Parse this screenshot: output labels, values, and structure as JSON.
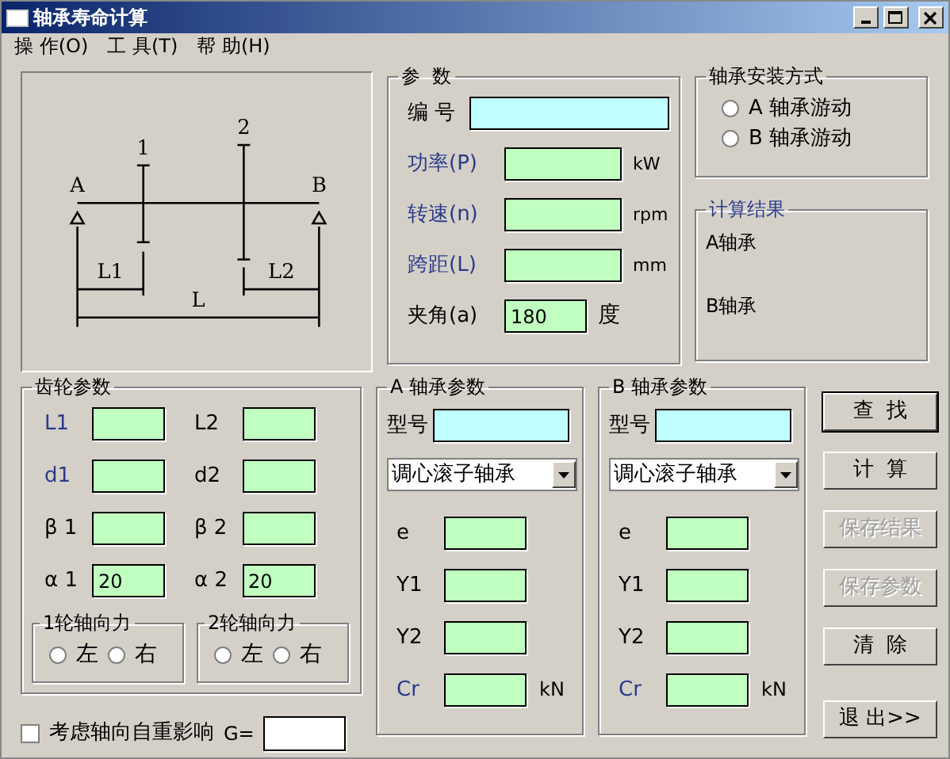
{
  "window": {
    "title": "轴承寿命计算"
  },
  "menu": [
    {
      "label": "操 作(O)"
    },
    {
      "label": "工 具(T)"
    },
    {
      "label": "帮 助(H)"
    }
  ],
  "diagram": {
    "labels": [
      "A",
      "B",
      "1",
      "2",
      "L1",
      "L2",
      "L"
    ]
  },
  "params": {
    "title": "参  数",
    "fields": [
      {
        "label": "编 号",
        "kind": "text",
        "highlighted": false
      },
      {
        "label": "功率(P)",
        "kind": "number",
        "highlighted": true,
        "unit": "kW"
      },
      {
        "label": "转速(n)",
        "kind": "number",
        "highlighted": true,
        "unit": "rpm"
      },
      {
        "label": "跨距(L)",
        "kind": "number",
        "highlighted": true,
        "unit": "mm"
      },
      {
        "label": "夹角(a)",
        "kind": "short",
        "highlighted": false,
        "value": "180",
        "unit": "度"
      }
    ]
  },
  "install": {
    "title": "轴承安装方式",
    "options": [
      {
        "label": "A 轴承游动",
        "selected": false
      },
      {
        "label": "B 轴承游动",
        "selected": false
      }
    ]
  },
  "results": {
    "title": "计算结果",
    "lines": [
      "A轴承",
      "B轴承"
    ]
  },
  "gear": {
    "title": "齿轮参数",
    "fields": [
      {
        "label": "L1",
        "highlighted": true
      },
      {
        "label": "L2",
        "highlighted": false
      },
      {
        "label": "d1",
        "highlighted": true
      },
      {
        "label": "d2",
        "highlighted": false
      },
      {
        "label": "β 1",
        "highlighted": false
      },
      {
        "label": "β 2",
        "highlighted": false
      },
      {
        "label": "α 1",
        "highlighted": false,
        "value": "20"
      },
      {
        "label": "α 2",
        "highlighted": false,
        "value": "20"
      }
    ],
    "axial": [
      {
        "title": "1轮轴向力",
        "options": [
          {
            "label": "左",
            "selected": false
          },
          {
            "label": "右",
            "selected": false
          }
        ]
      },
      {
        "title": "2轮轴向力",
        "options": [
          {
            "label": "左",
            "selected": false
          },
          {
            "label": "右",
            "selected": false
          }
        ]
      }
    ]
  },
  "bearings": [
    {
      "title": "A 轴承参数",
      "model_label": "型号",
      "type": "调心滚子轴承",
      "fields": [
        {
          "label": "e",
          "highlighted": false
        },
        {
          "label": "Y1",
          "highlighted": false
        },
        {
          "label": "Y2",
          "highlighted": false
        },
        {
          "label": "Cr",
          "highlighted": true,
          "unit": "kN"
        }
      ]
    },
    {
      "title": "B 轴承参数",
      "model_label": "型号",
      "type": "调心滚子轴承",
      "fields": [
        {
          "label": "e",
          "highlighted": false
        },
        {
          "label": "Y1",
          "highlighted": false
        },
        {
          "label": "Y2",
          "highlighted": false
        },
        {
          "label": "Cr",
          "highlighted": true,
          "unit": "kN"
        }
      ]
    }
  ],
  "buttons": [
    {
      "label": "查  找",
      "disabled": false,
      "focused": true
    },
    {
      "label": "计  算",
      "disabled": false,
      "focused": false
    },
    {
      "label": "保存结果",
      "disabled": true,
      "focused": false
    },
    {
      "label": "保存参数",
      "disabled": true,
      "focused": false
    },
    {
      "label": "清  除",
      "disabled": false,
      "focused": false
    },
    {
      "label": "退 出>>",
      "disabled": false,
      "focused": false
    }
  ],
  "gravity": {
    "label": "考虑轴向自重影响",
    "checked": false,
    "g_label": "G="
  }
}
